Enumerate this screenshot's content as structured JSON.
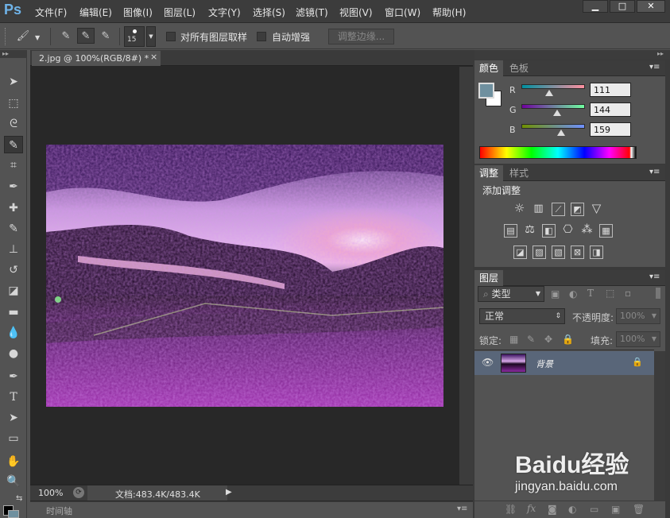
{
  "app": {
    "logo": "Ps"
  },
  "menu": [
    "文件(F)",
    "编辑(E)",
    "图像(I)",
    "图层(L)",
    "文字(Y)",
    "选择(S)",
    "滤镜(T)",
    "视图(V)",
    "窗口(W)",
    "帮助(H)"
  ],
  "window_buttons": {
    "minimize": "▁",
    "maximize": "□",
    "close": "✕"
  },
  "options": {
    "brush_size": "15",
    "sample_all_layers": "对所有图层取样",
    "auto_enhance": "自动增强",
    "refine_edge": "调整边缘..."
  },
  "document": {
    "tab_title": "2.jpg @ 100%(RGB/8#) *",
    "tab_close": "×",
    "zoom": "100%",
    "doc_size": "文档:483.4K/483.4K",
    "timeline": "时间轴"
  },
  "color_panel": {
    "tabs": [
      "颜色",
      "色板"
    ],
    "r_label": "R",
    "g_label": "G",
    "b_label": "B",
    "r": "111",
    "g": "144",
    "b": "159",
    "r_level": 0.435,
    "g_level": 0.565,
    "b_level": 0.624,
    "foreground": "#6f909f",
    "background": "#ffffff"
  },
  "adjust_panel": {
    "tabs": [
      "调整",
      "样式"
    ],
    "title": "添加调整"
  },
  "layers_panel": {
    "tabs": [
      "图层"
    ],
    "filter": "类型",
    "blend_mode": "正常",
    "opacity_label": "不透明度:",
    "opacity_value": "100%",
    "lock_label": "锁定:",
    "fill_label": "填充:",
    "fill_value": "100%",
    "layers": [
      {
        "name": "背景"
      }
    ]
  },
  "watermark": {
    "brand": "Baidu经验",
    "url": "jingyan.baidu.com"
  },
  "colors": {
    "accent": "#6fb3e8",
    "panel": "#535353",
    "dark": "#3c3c3c",
    "canvas": "#282828",
    "layer_selected": "#596679"
  }
}
